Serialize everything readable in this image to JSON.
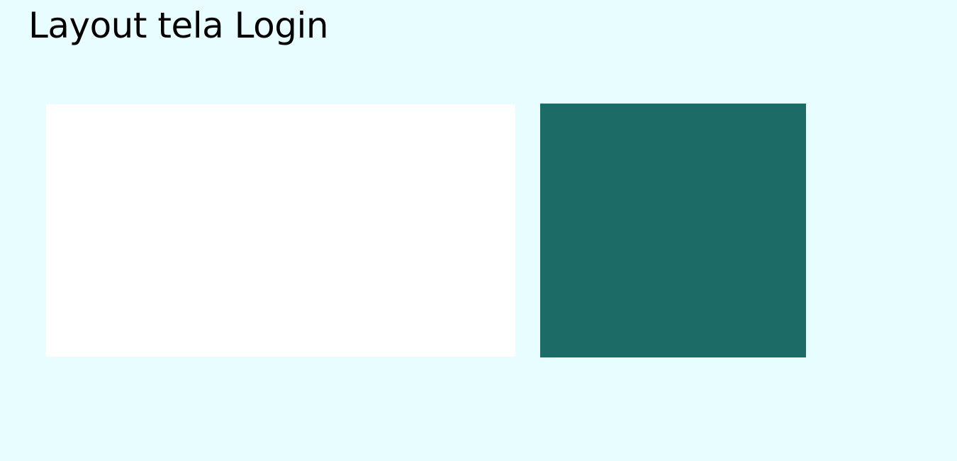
{
  "page": {
    "title": "Layout tela Login"
  },
  "colors": {
    "background": "#e8fdff",
    "left_panel": "#ffffff",
    "right_panel": "#1c6b67"
  }
}
